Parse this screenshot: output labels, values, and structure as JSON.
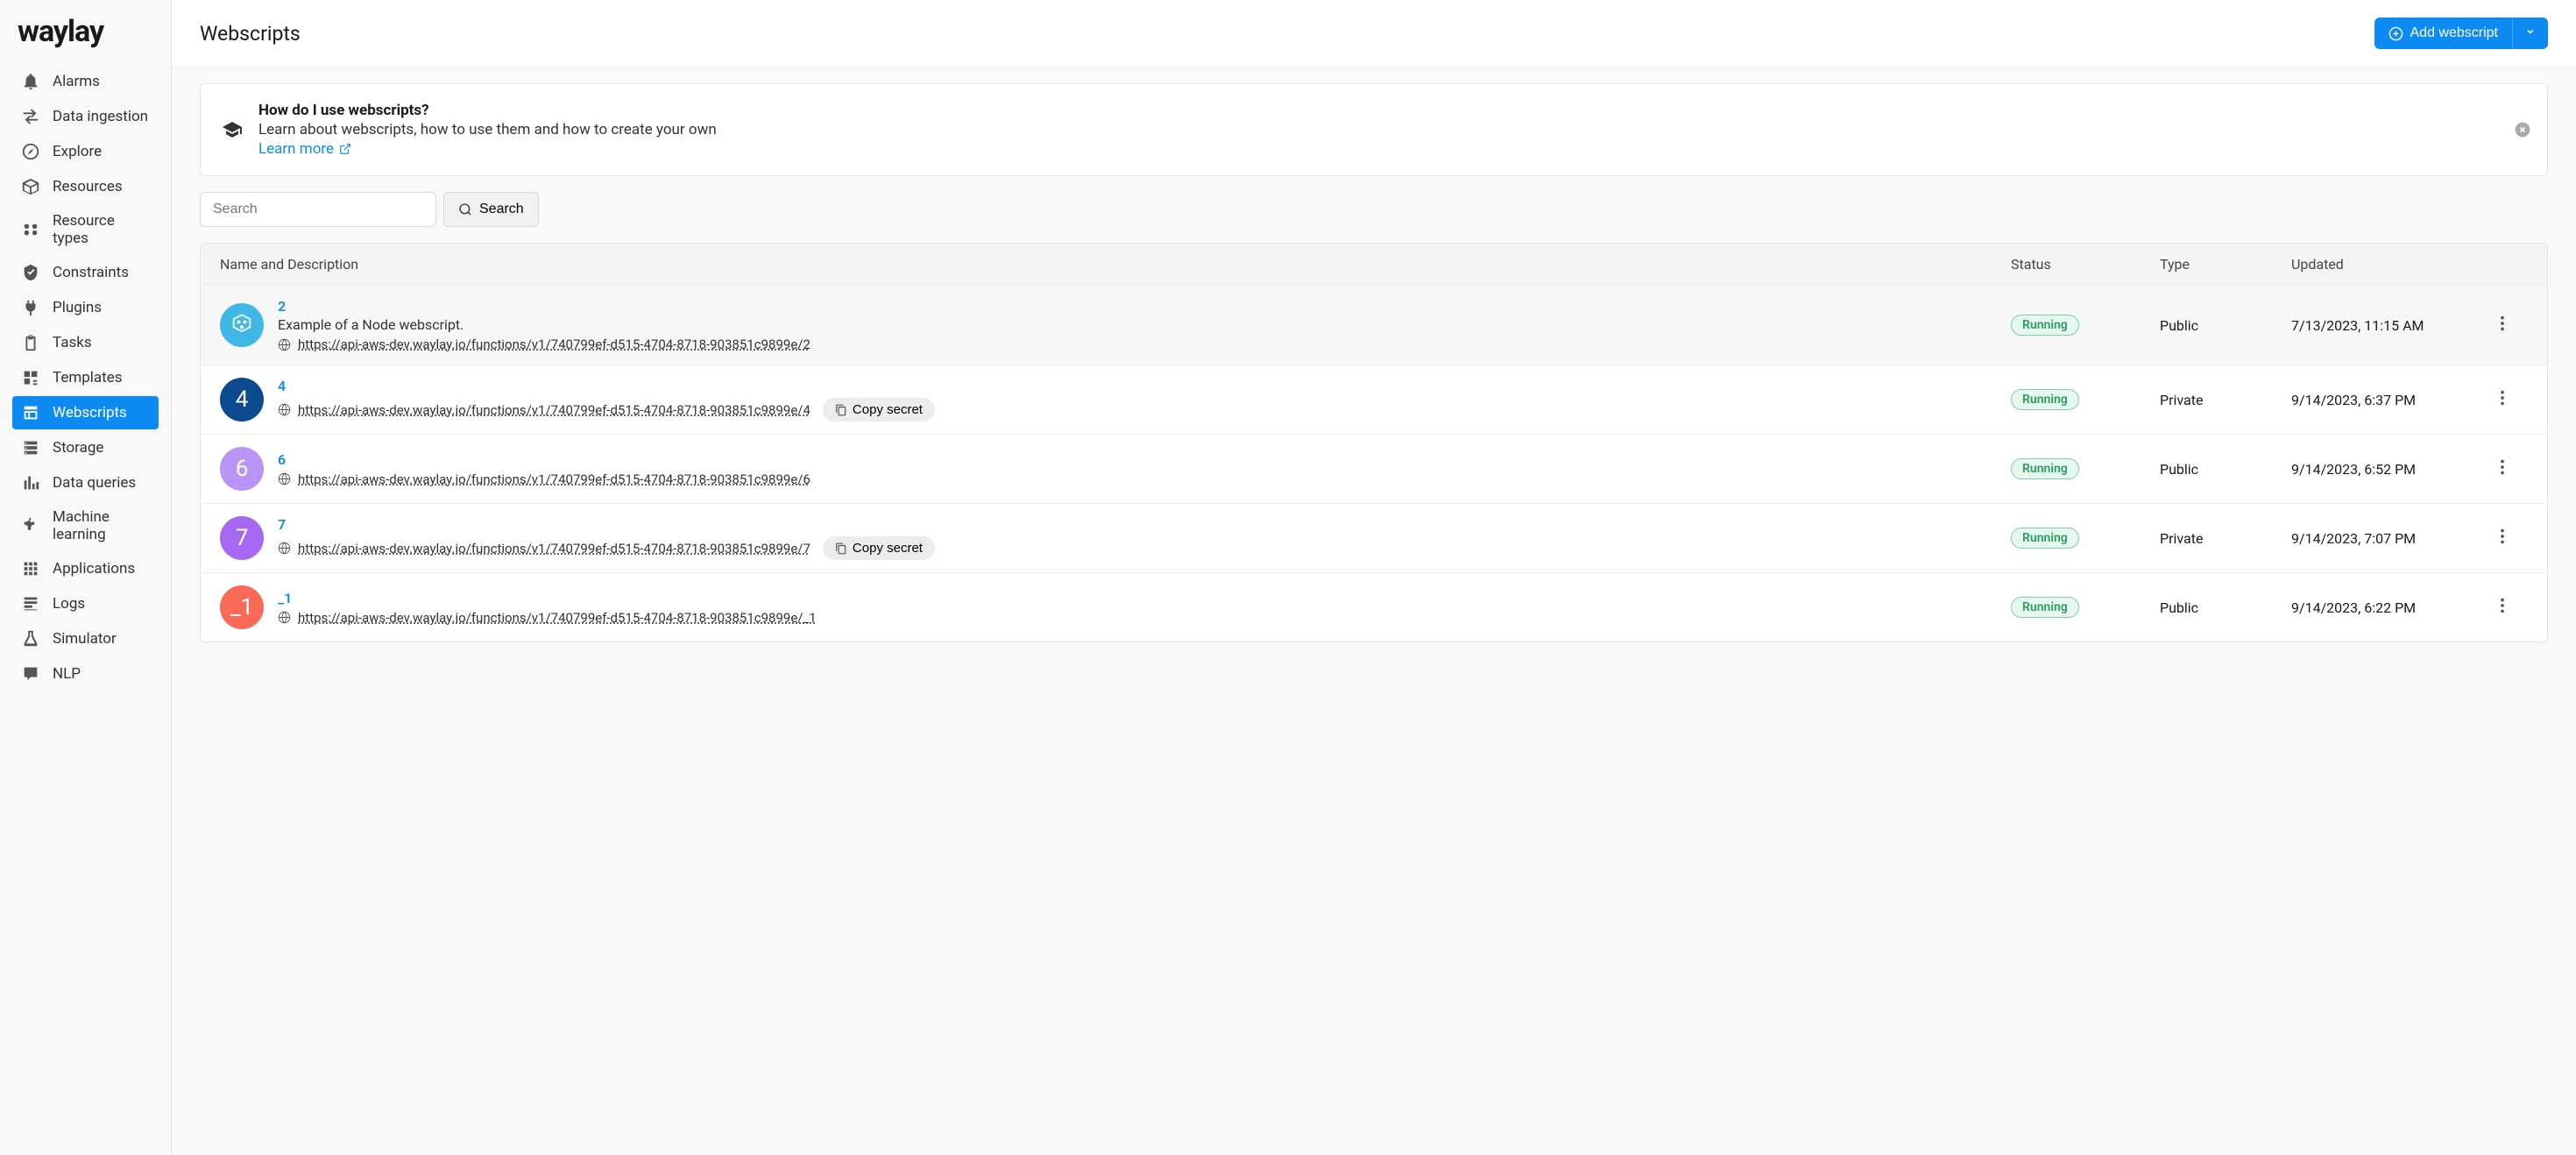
{
  "brand": "waylay",
  "nav": [
    {
      "icon": "bell",
      "label": "Alarms"
    },
    {
      "icon": "ingest",
      "label": "Data ingestion"
    },
    {
      "icon": "compass",
      "label": "Explore"
    },
    {
      "icon": "box",
      "label": "Resources"
    },
    {
      "icon": "types",
      "label": "Resource types"
    },
    {
      "icon": "shield",
      "label": "Constraints"
    },
    {
      "icon": "plug",
      "label": "Plugins"
    },
    {
      "icon": "clipboard",
      "label": "Tasks"
    },
    {
      "icon": "template",
      "label": "Templates"
    },
    {
      "icon": "webscript",
      "label": "Webscripts",
      "active": true
    },
    {
      "icon": "storage",
      "label": "Storage"
    },
    {
      "icon": "chart",
      "label": "Data queries"
    },
    {
      "icon": "ml",
      "label": "Machine learning"
    },
    {
      "icon": "apps",
      "label": "Applications"
    },
    {
      "icon": "logs",
      "label": "Logs"
    },
    {
      "icon": "flask",
      "label": "Simulator"
    },
    {
      "icon": "nlp",
      "label": "NLP"
    }
  ],
  "page": {
    "title": "Webscripts",
    "add_button": "Add webscript"
  },
  "banner": {
    "title": "How do I use webscripts?",
    "text": "Learn about webscripts, how to use them and how to create your own",
    "link": "Learn more"
  },
  "search": {
    "placeholder": "Search",
    "button": "Search"
  },
  "columns": {
    "name": "Name and Description",
    "status": "Status",
    "type": "Type",
    "updated": "Updated"
  },
  "rows": [
    {
      "avatar_text": "",
      "avatar_bg": "#3fb8e8",
      "avatar_icon": true,
      "name": "2",
      "desc": "Example of a Node webscript.",
      "url": "https://api-aws-dev.waylay.io/functions/v1/740799ef-d515-4704-8718-903851c9899e/2",
      "status": "Running",
      "type": "Public",
      "updated": "7/13/2023, 11:15 AM",
      "hover": true,
      "copy": false
    },
    {
      "avatar_text": "4",
      "avatar_bg": "#0d4a8f",
      "name": "4",
      "desc": "",
      "url": "https://api-aws-dev.waylay.io/functions/v1/740799ef-d515-4704-8718-903851c9899e/4",
      "status": "Running",
      "type": "Private",
      "updated": "9/14/2023, 6:37 PM",
      "copy": true
    },
    {
      "avatar_text": "6",
      "avatar_bg": "#b993f5",
      "name": "6",
      "desc": "",
      "url": "https://api-aws-dev.waylay.io/functions/v1/740799ef-d515-4704-8718-903851c9899e/6",
      "status": "Running",
      "type": "Public",
      "updated": "9/14/2023, 6:52 PM",
      "copy": false
    },
    {
      "avatar_text": "7",
      "avatar_bg": "#a668f2",
      "name": "7",
      "desc": "",
      "url": "https://api-aws-dev.waylay.io/functions/v1/740799ef-d515-4704-8718-903851c9899e/7",
      "status": "Running",
      "type": "Private",
      "updated": "9/14/2023, 7:07 PM",
      "copy": true
    },
    {
      "avatar_text": "_1",
      "avatar_bg": "#fa6a57",
      "name": "_1",
      "desc": "",
      "url": "https://api-aws-dev.waylay.io/functions/v1/740799ef-d515-4704-8718-903851c9899e/_1",
      "status": "Running",
      "type": "Public",
      "updated": "9/14/2023, 6:22 PM",
      "copy": false
    }
  ],
  "copy_label": "Copy secret"
}
